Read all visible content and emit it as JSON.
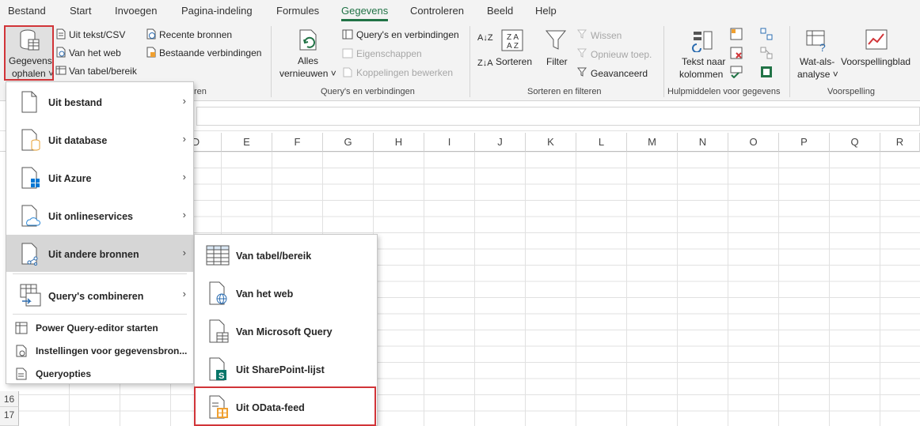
{
  "tabs": [
    "Bestand",
    "Start",
    "Invoegen",
    "Pagina-indeling",
    "Formules",
    "Gegevens",
    "Controleren",
    "Beeld",
    "Help"
  ],
  "active_tab": "Gegevens",
  "ribbon": {
    "get_data_line1": "Gegevens",
    "get_data_line2": "ophalen ˅",
    "from_text_csv": "Uit tekst/CSV",
    "from_web": "Van het web",
    "from_table": "Van tabel/bereik",
    "recent_sources": "Recente bronnen",
    "existing_connections": "Bestaande verbindingen",
    "group_get_transform_tail": "ren",
    "refresh_all_line1": "Alles",
    "refresh_all_line2": "vernieuwen ˅",
    "queries_connections": "Query's en verbindingen",
    "properties": "Eigenschappen",
    "edit_links": "Koppelingen bewerken",
    "group_queries": "Query's en verbindingen",
    "sort_az": "A↓Z",
    "sort_za": "Z↓A",
    "sort": "Sorteren",
    "filter": "Filter",
    "clear": "Wissen",
    "reapply": "Opnieuw toep.",
    "advanced": "Geavanceerd",
    "group_sort_filter": "Sorteren en filteren",
    "text_to_columns_line1": "Tekst naar",
    "text_to_columns_line2": "kolommen",
    "group_data_tools": "Hulpmiddelen voor gegevens",
    "what_if_line1": "Wat-als-",
    "what_if_line2": "analyse ˅",
    "forecast_sheet": "Voorspellingblad",
    "group_forecast": "Voorspelling"
  },
  "columns": [
    "D",
    "E",
    "F",
    "G",
    "H",
    "I",
    "J",
    "K",
    "L",
    "M",
    "N",
    "O",
    "P",
    "Q",
    "R"
  ],
  "rows": [
    "16",
    "17"
  ],
  "menu": {
    "items": [
      {
        "label": "Uit bestand",
        "icon": "file-icon"
      },
      {
        "label": "Uit database",
        "icon": "database-icon"
      },
      {
        "label": "Uit Azure",
        "icon": "azure-icon"
      },
      {
        "label": "Uit onlineservices",
        "icon": "cloud-icon"
      },
      {
        "label": "Uit andere bronnen",
        "icon": "other-sources-icon"
      },
      {
        "label": "Query's combineren",
        "icon": "combine-icon"
      }
    ],
    "small_items": [
      "Power Query-editor starten",
      "Instellingen voor gegevensbron...",
      "Queryopties"
    ],
    "arrow": "›"
  },
  "submenu": {
    "items": [
      {
        "label": "Van tabel/bereik",
        "icon": "table-icon"
      },
      {
        "label": "Van het web",
        "icon": "web-icon"
      },
      {
        "label": "Van Microsoft Query",
        "icon": "ms-query-icon"
      },
      {
        "label": "Uit SharePoint-lijst",
        "icon": "sharepoint-icon"
      },
      {
        "label": "Uit OData-feed",
        "icon": "odata-icon"
      }
    ]
  },
  "colors": {
    "accent": "#217346",
    "highlight_box": "#d13438",
    "hover": "#d6d6d6"
  }
}
